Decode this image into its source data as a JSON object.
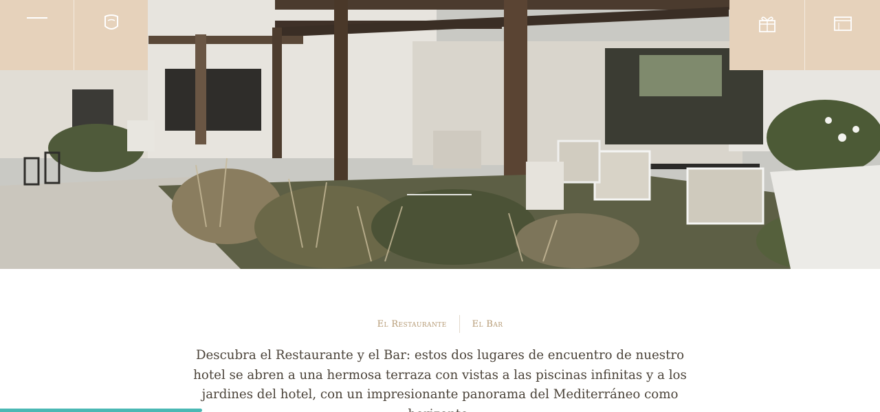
{
  "header": {
    "left": [
      {
        "name": "menu",
        "icon": "menu-icon"
      },
      {
        "name": "logo",
        "icon": "hotel-logo-icon"
      }
    ],
    "right": [
      {
        "name": "gift",
        "icon": "gift-icon"
      },
      {
        "name": "booking",
        "icon": "calendar-icon"
      }
    ]
  },
  "colors": {
    "topbar": "#e6d2bb",
    "tab_text": "#b59a74",
    "body_text": "#4a4238",
    "progress": "#4bb8b4"
  },
  "tabs": [
    {
      "label": "El Restaurante"
    },
    {
      "label": "El Bar"
    }
  ],
  "intro": {
    "text": "Descubra el Restaurante y el Bar: estos dos lugares de encuentro de nuestro hotel se abren a una hermosa terraza con vistas a las piscinas infinitas y a los jardines del hotel, con un impresionante panorama del Mediterráneo como horizonte."
  },
  "progress": {
    "value": 0.23
  }
}
